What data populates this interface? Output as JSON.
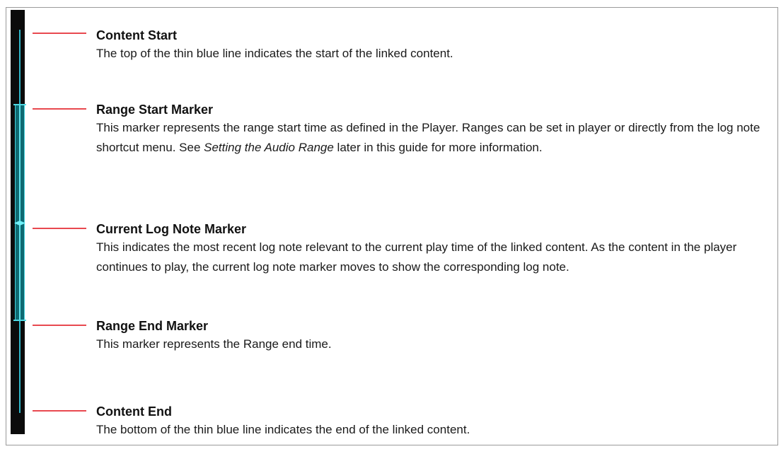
{
  "colors": {
    "pointer": "#e8494f",
    "timeline_bar": "#0b0b0b",
    "content_line": "#2fb6c8",
    "range_band": "#0e6a72",
    "log_marker": "#6ff0f8"
  },
  "entries": [
    {
      "title": "Content Start",
      "description": "The top of the thin blue line indicates the start of the linked content."
    },
    {
      "title": "Range Start Marker",
      "description_part1": "This marker represents the range start time as defined in the Player.  Ranges can be set in player or directly from the log note shortcut menu.  See ",
      "description_emphasis": "Setting the Audio Range",
      "description_part2": " later in this guide for more information."
    },
    {
      "title": "Current Log Note Marker",
      "description": "This indicates the most recent log note relevant to the current play time of the linked content. As the content in the player continues to play, the current log note marker moves to show the corresponding log note."
    },
    {
      "title": "Range End Marker",
      "description": "This marker represents the Range end time."
    },
    {
      "title": "Content End",
      "description": "The bottom of the thin blue line indicates the end of the linked content."
    }
  ]
}
